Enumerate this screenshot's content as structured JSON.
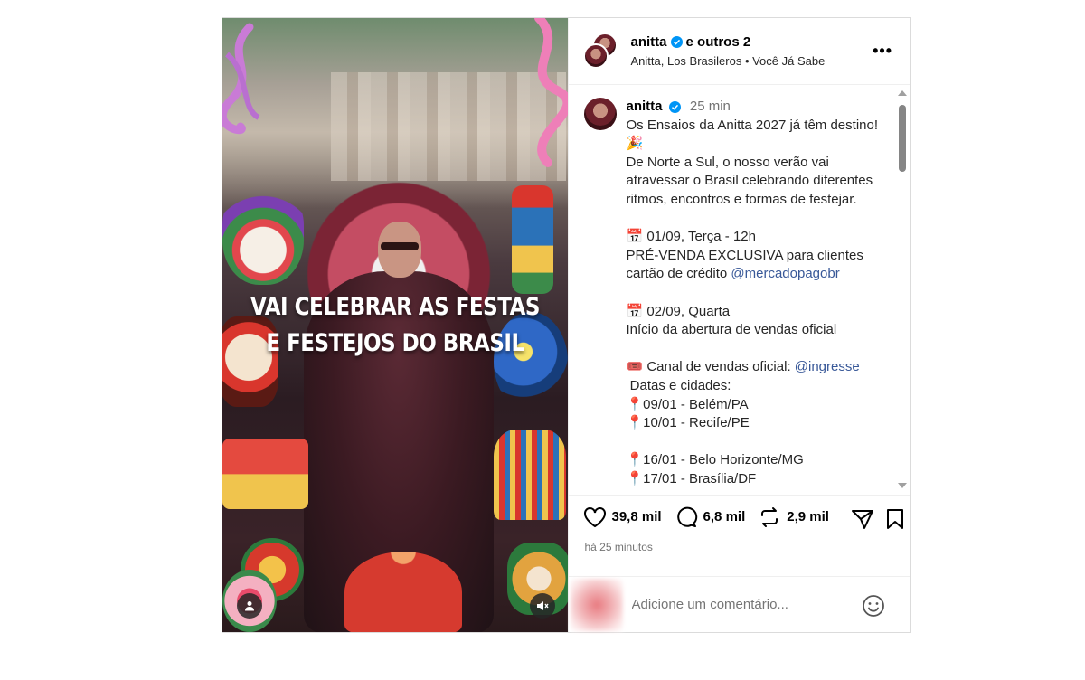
{
  "header": {
    "username": "anitta",
    "others": "e outros 2",
    "collaborators_line": "Anitta, Los Brasileros • Você Já Sabe"
  },
  "media": {
    "overlay_line1": "VAI CELEBRAR AS FESTAS",
    "overlay_line2": "E FESTEJOS DO BRASIL"
  },
  "caption": {
    "username": "anitta",
    "time": "25 min",
    "lines": [
      {
        "text": "Os Ensaios da Anitta 2027 já têm destino! 🎉"
      },
      {
        "text": "De Norte a Sul, o nosso verão vai atravessar o Brasil celebrando diferentes ritmos, encontros e formas de festejar."
      },
      {
        "text": ""
      },
      {
        "text": "📅 01/09, Terça - 12h"
      },
      {
        "text": "PRÉ-VENDA EXCLUSIVA para clientes cartão de crédito ",
        "link": "@mercadopagobr"
      },
      {
        "text": ""
      },
      {
        "text": "📅 02/09, Quarta"
      },
      {
        "text": "Início da abertura de vendas oficial"
      },
      {
        "text": ""
      },
      {
        "text": "🎟️ Canal de vendas oficial: ",
        "link": "@ingresse"
      },
      {
        "text": " Datas e cidades:"
      },
      {
        "text": "📍09/01 - Belém/PA"
      },
      {
        "text": "📍10/01 - Recife/PE"
      },
      {
        "text": ""
      },
      {
        "text": "📍16/01 - Belo Horizonte/MG"
      },
      {
        "text": "📍17/01 - Brasília/DF"
      }
    ]
  },
  "actions": {
    "likes": "39,8 mil",
    "comments": "6,8 mil",
    "reposts": "2,9 mil"
  },
  "timestamp": "há 25 minutos",
  "comment_bar": {
    "placeholder": "Adicione um comentário..."
  },
  "icons": [
    "verified-icon",
    "more-options-icon",
    "heart-icon",
    "comment-icon",
    "repost-icon",
    "share-icon",
    "bookmark-icon",
    "emoji-icon",
    "user-tag-icon",
    "mute-icon"
  ],
  "colors": {
    "verified": "#0095f6",
    "link": "#385898",
    "muted_text": "#737373"
  }
}
